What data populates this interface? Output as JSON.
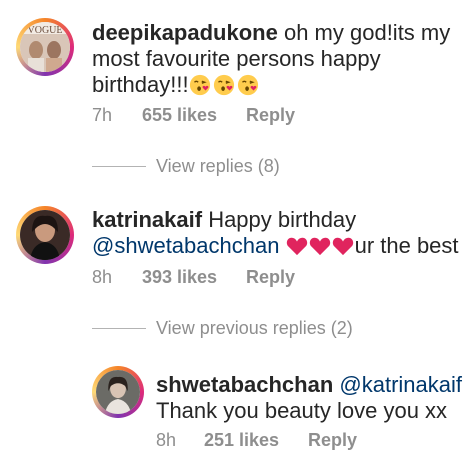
{
  "comments": [
    {
      "username": "deepikapadukone",
      "text": "oh my god!its my most favourite persons happy birthday!!!",
      "emoji": [
        "kissing-heart-emoji",
        "kissing-heart-emoji",
        "kissing-heart-emoji"
      ],
      "time": "7h",
      "likes": "655 likes",
      "reply": "Reply",
      "view_replies": "View replies (8)"
    },
    {
      "username": "katrinakaif",
      "text": "Happy birthday",
      "mention": "@shwetabachchan",
      "hearts": [
        "red-heart-emoji",
        "red-heart-emoji",
        "red-heart-emoji"
      ],
      "suffix": "ur the best",
      "time": "8h",
      "likes": "393 likes",
      "reply": "Reply",
      "view_replies": "View previous replies (2)"
    },
    {
      "username": "shwetabachchan",
      "mention": "@katrinakaif",
      "text": "Thank you beauty love you xx",
      "time": "8h",
      "likes": "251 likes",
      "reply": "Reply"
    }
  ],
  "colors": {
    "text": "#262626",
    "muted": "#8e8e8e",
    "mention": "#00376b",
    "heart": "#e0245e",
    "ring": "#dd2a7b"
  }
}
